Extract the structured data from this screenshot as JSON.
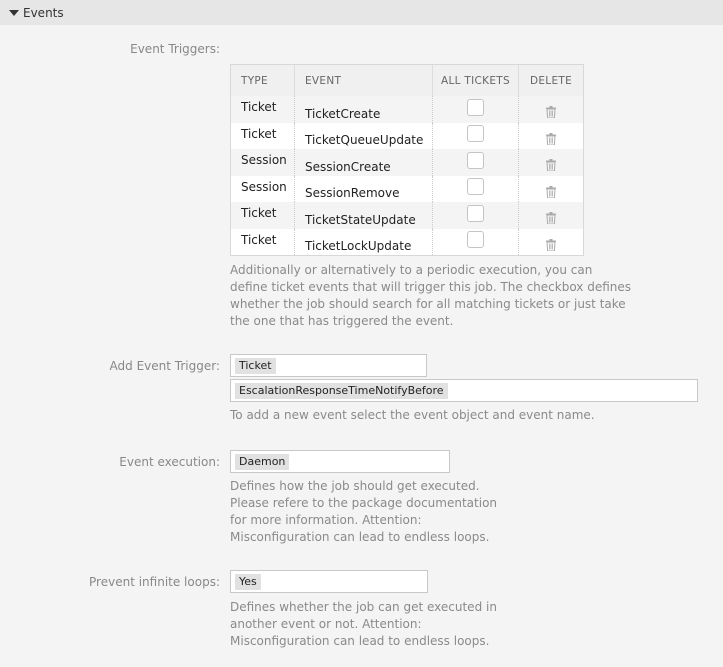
{
  "section": {
    "title": "Events",
    "expanded": true
  },
  "event_triggers": {
    "label": "Event Triggers:",
    "columns": [
      "TYPE",
      "EVENT",
      "ALL TICKETS",
      "DELETE"
    ],
    "rows": [
      {
        "type": "Ticket",
        "event": "TicketCreate",
        "all_tickets": false
      },
      {
        "type": "Ticket",
        "event": "TicketQueueUpdate",
        "all_tickets": false
      },
      {
        "type": "Session",
        "event": "SessionCreate",
        "all_tickets": false
      },
      {
        "type": "Session",
        "event": "SessionRemove",
        "all_tickets": false
      },
      {
        "type": "Ticket",
        "event": "TicketStateUpdate",
        "all_tickets": false
      },
      {
        "type": "Ticket",
        "event": "TicketLockUpdate",
        "all_tickets": false
      }
    ],
    "delete_icon": "trash-icon",
    "help_lines": [
      "Additionally or alternatively to a periodic execution, you can",
      "define ticket events that will trigger this job. The checkbox defines",
      "whether the job should search for all matching tickets or just take",
      "the one that has triggered the event."
    ]
  },
  "add_event_trigger": {
    "label": "Add Event Trigger:",
    "object_value": "Ticket",
    "event_value": "EscalationResponseTimeNotifyBefore",
    "help": "To add a new event select the event object and event name."
  },
  "event_execution": {
    "label": "Event execution:",
    "value": "Daemon",
    "help_lines": [
      "Defines how the job should get executed.",
      "Please refere to the package documentation",
      "for more information. Attention:",
      "Misconfiguration can lead to endless loops."
    ]
  },
  "prevent_loops": {
    "label": "Prevent infinite loops:",
    "value": "Yes",
    "help_lines": [
      "Defines whether the job can get executed in",
      "another event or not. Attention:",
      "Misconfiguration can lead to endless loops."
    ]
  }
}
